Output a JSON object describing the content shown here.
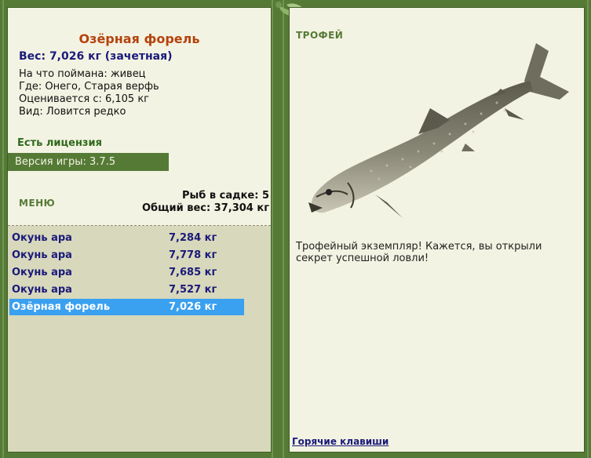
{
  "fish": {
    "title": "Озёрная форель",
    "weight_line": "Вес: 7,026 кг (зачетная)",
    "caught_on": "На что поймана: живец",
    "location": "Где: Онего, Старая верфь",
    "valued_from": "Оценивается с: 6,105 кг",
    "kind": "Вид: Ловится редко"
  },
  "license": "Есть лицензия",
  "version": "Версия игры: 3.7.5",
  "menu_label": "МЕНЮ",
  "keep": {
    "count_line": "Рыб в садке: 5",
    "total_line": "Общий вес: 37,304 кг"
  },
  "catch_list": [
    {
      "name": "Окунь ара",
      "weight": "7,284 кг"
    },
    {
      "name": "Окунь ара",
      "weight": "7,778 кг"
    },
    {
      "name": "Окунь ара",
      "weight": "7,685 кг"
    },
    {
      "name": "Окунь ара",
      "weight": "7,527 кг"
    },
    {
      "name": "Озёрная форель",
      "weight": "7,026 кг"
    }
  ],
  "trophy": {
    "label": "ТРОФЕЙ",
    "text": "Трофейный экземпляр! Кажется, вы открыли секрет успешной ловли!",
    "image_icon": "trout-image"
  },
  "hotkeys_link": "Горячие клавиши",
  "colors": {
    "frame": "#557a36",
    "panel": "#f3f3e3",
    "list_bg": "#d8d8bc",
    "title": "#b5430e",
    "link": "#1a1a7a",
    "selected": "#3aa0f0"
  }
}
